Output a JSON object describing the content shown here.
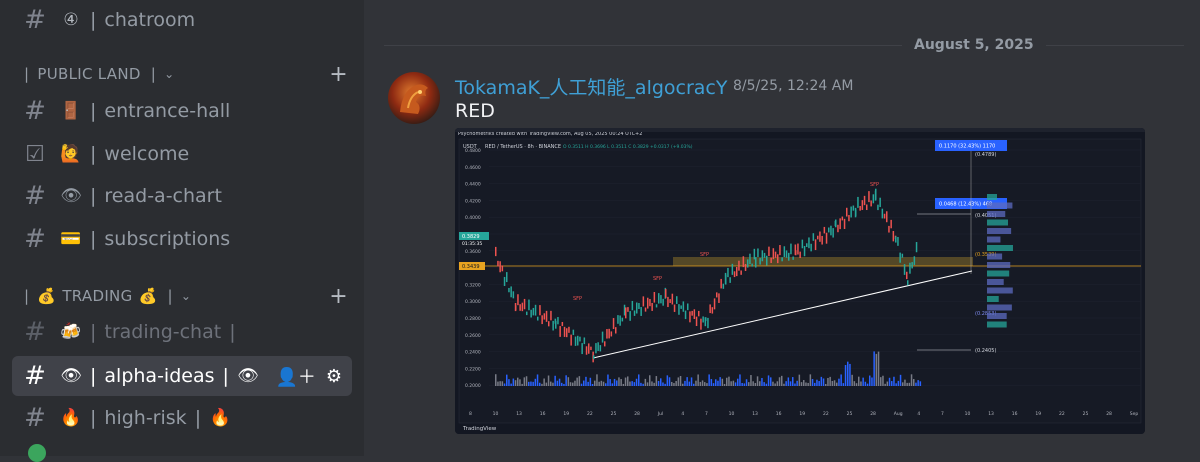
{
  "sidebar": {
    "channels_top": [
      {
        "emoji": "④",
        "name": "chatroom"
      }
    ],
    "categories": [
      {
        "label": "PUBLIC LAND",
        "prefix": "",
        "suffix": ""
      },
      {
        "label": "TRADING",
        "prefix": "💰",
        "suffix": "💰"
      }
    ],
    "public_land": [
      {
        "icon": "#",
        "emoji": "🚪",
        "name": "entrance-hall",
        "post": ""
      },
      {
        "icon": "☑",
        "emoji": "🙋",
        "name": "welcome",
        "post": ""
      },
      {
        "icon": "#",
        "emoji": "👁",
        "name": "read-a-chart",
        "post": ""
      },
      {
        "icon": "#",
        "emoji": "💳",
        "name": "subscriptions",
        "post": ""
      }
    ],
    "trading": [
      {
        "icon": "#",
        "emoji": "🍻",
        "name": "trading-chat",
        "post": "|"
      },
      {
        "icon": "#",
        "emoji": "👁",
        "name": "alpha-ideas",
        "post": "|"
      },
      {
        "icon": "#",
        "emoji": "🔥",
        "name": "high-risk",
        "post": "|"
      }
    ],
    "separator": "|"
  },
  "main": {
    "date_divider": "August 5, 2025",
    "message": {
      "author": "TokamaK_人工知能_algocracY",
      "timestamp": "8/5/25, 12:24 AM",
      "text": "RED"
    }
  },
  "chart": {
    "header_line": "Psychometriks created with TradingView.com, Aug 05, 2025 00:24 UTC+2",
    "symbol_line": "RED / TetherUS · 8h · BINANCE",
    "ohlc": "O 0.3511  H 0.3696  L 0.3511  C 0.3829  +0.0317 (+9.03%)",
    "currency": "USDT",
    "price_tag": "0.3829",
    "price_tag2": "0.3439",
    "countdown": "01:35:35",
    "boxes": [
      "0.1170 (32.43%) 1170",
      "0.0468 (12.43%) 468"
    ],
    "levels": [
      "(0.4789)",
      "(0.4051)",
      "(0.3539)",
      "(0.2853)",
      "(0.2405)"
    ],
    "sfp": "SFP",
    "watermark": "TradingView",
    "axis_y": [
      "0.4800",
      "0.4600",
      "0.4400",
      "0.4200",
      "0.4000",
      "0.3800",
      "0.3600",
      "0.3400",
      "0.3200",
      "0.3000",
      "0.2800",
      "0.2600",
      "0.2400",
      "0.2200",
      "0.2000"
    ],
    "axis_x": [
      "8",
      "10",
      "13",
      "16",
      "19",
      "22",
      "25",
      "28",
      "Jul",
      "4",
      "7",
      "10",
      "13",
      "16",
      "19",
      "22",
      "25",
      "28",
      "Aug",
      "4",
      "7",
      "10",
      "13",
      "16",
      "19",
      "22",
      "25",
      "28",
      "Sep"
    ],
    "colors": {
      "bg": "#131722",
      "up": "#26a69a",
      "down": "#ef5350",
      "zone": "#c8a02a",
      "box": "#2962ff"
    }
  }
}
